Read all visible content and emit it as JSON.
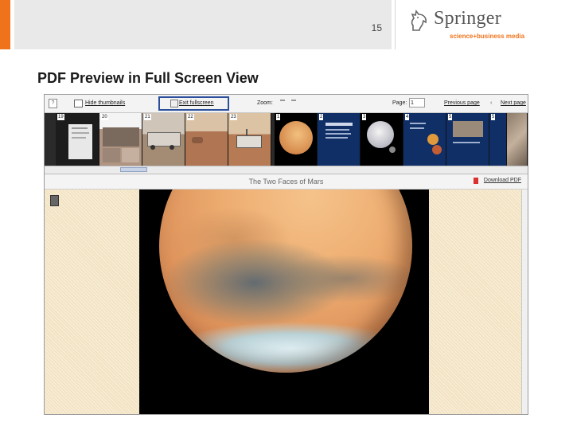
{
  "slide": {
    "page_number": "15",
    "title": "PDF Preview in Full Screen View",
    "accent_color": "#f0731b"
  },
  "logo": {
    "name": "Springer",
    "tagline": "science+business media",
    "icon": "knight-horse-icon"
  },
  "viewer": {
    "toolbar": {
      "help_icon": "?",
      "hide_thumbnails": "Hide thumbnails",
      "exit_fullscreen": "Exit fullscreen",
      "zoom_label": "Zoom:",
      "page_label": "Page:",
      "page_value": "1",
      "previous_page": "Previous page",
      "next_page": "Next page",
      "highlight_color": "#2b4f9b"
    },
    "thumbnails": [
      {
        "num": "19",
        "style": "doc-dark"
      },
      {
        "num": "20",
        "style": "rover-photo"
      },
      {
        "num": "21",
        "style": "rover-photo"
      },
      {
        "num": "22",
        "style": "mars-surface"
      },
      {
        "num": "23",
        "style": "mars-surface"
      },
      {
        "num": "1",
        "style": "mars-globe"
      },
      {
        "num": "2",
        "style": "doc-blue"
      },
      {
        "num": "3",
        "style": "moon"
      },
      {
        "num": "4",
        "style": "doc-blue-planets"
      },
      {
        "num": "5",
        "style": "doc-blue-photo"
      },
      {
        "num": "5",
        "style": "doc-blue"
      },
      {
        "num": "",
        "style": "rock"
      }
    ],
    "document_title": "The Two Faces of Mars",
    "download_label": "Download PDF"
  }
}
